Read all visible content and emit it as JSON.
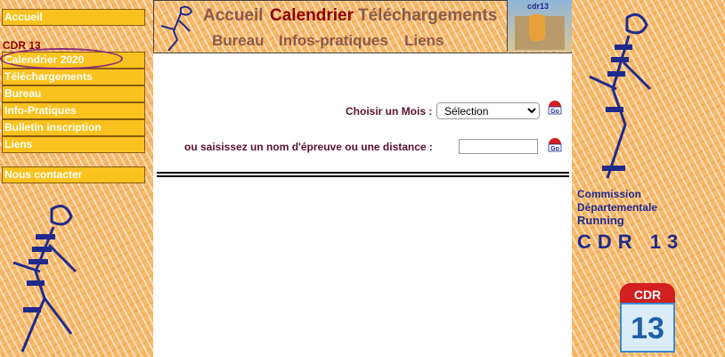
{
  "left_menu": {
    "home": "Accueil",
    "section_title": "CDR 13",
    "items": [
      "Calendrier 2020",
      "Téléchargements",
      "Bureau",
      "Info-Pratiques",
      "Bulletin inscription",
      "Liens"
    ],
    "contact": "Nous contacter"
  },
  "banner": {
    "row1": [
      "Accueil",
      "Calendrier",
      "Téléchargements"
    ],
    "row2": [
      "Bureau",
      "Infos-pratiques",
      "Liens"
    ],
    "active": "Calendrier",
    "photo_caption": "cdr13"
  },
  "form": {
    "month_label": "Choisir un Mois :",
    "month_selected": "Sélection",
    "search_label": "ou saisissez un nom d'épreuve ou une distance :",
    "search_value": "",
    "go_label": "Go"
  },
  "right_panel": {
    "line1": "Commission",
    "line2": "Départementale",
    "line3": "Running",
    "big": "CDR 13",
    "logo_top": "CDR",
    "logo_num": "13"
  },
  "colors": {
    "orange": "#f6b869",
    "menu_yellow": "#f9c21e",
    "dark_red": "#8b0000",
    "blue": "#1f2a8c"
  }
}
